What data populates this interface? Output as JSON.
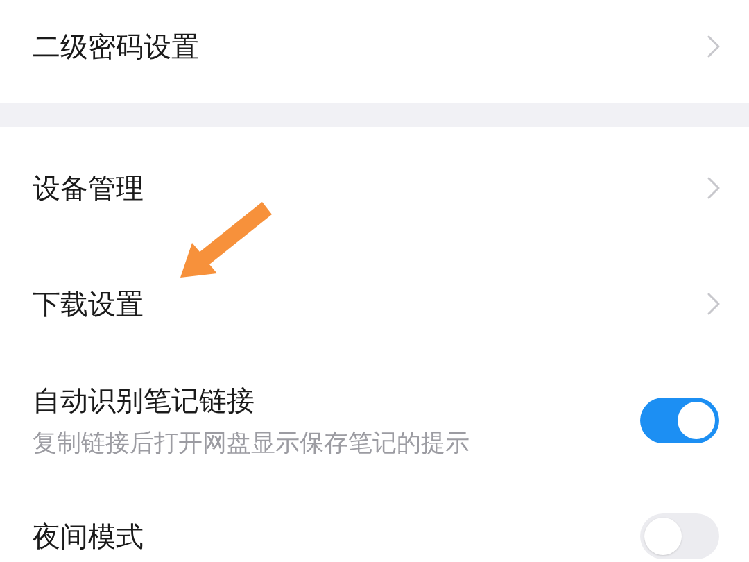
{
  "sections": [
    {
      "rows": [
        {
          "kind": "link",
          "label": "二级密码设置"
        }
      ]
    },
    {
      "rows": [
        {
          "kind": "link",
          "label": "设备管理"
        },
        {
          "kind": "link",
          "label": "下载设置"
        },
        {
          "kind": "toggle",
          "label": "自动识别笔记链接",
          "subtitle": "复制链接后打开网盘显示保存笔记的提示",
          "on": true
        },
        {
          "kind": "toggle",
          "label": "夜间模式",
          "on": false
        }
      ]
    }
  ]
}
